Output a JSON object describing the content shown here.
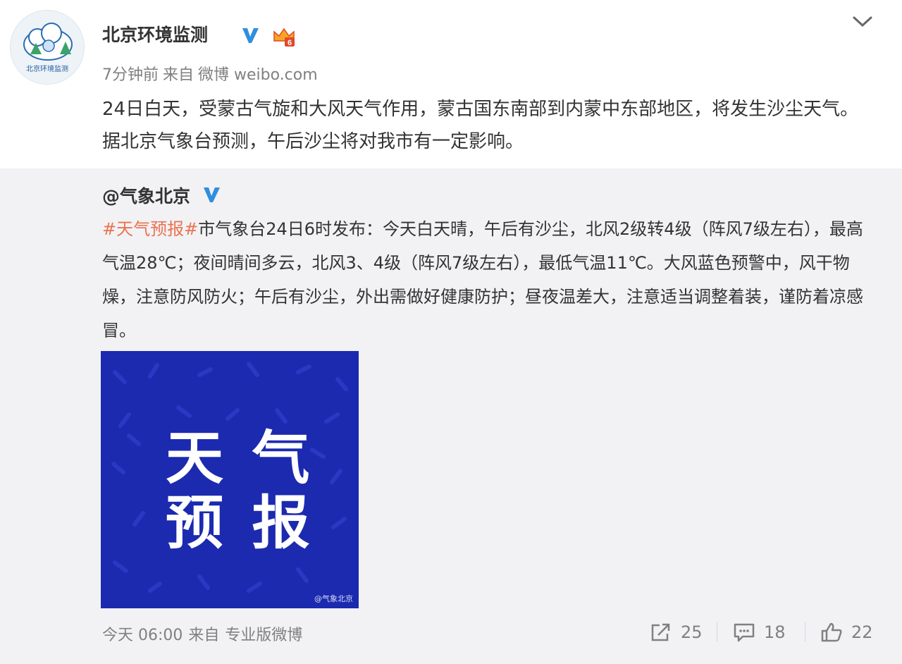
{
  "post": {
    "author": "北京环境监测",
    "avatar_caption": "北京环境监测",
    "time": "7分钟前",
    "source_prefix": "来自",
    "source": "微博 weibo.com",
    "text": "24日白天，受蒙古气旋和大风天气作用，蒙古国东南部到内蒙中东部地区，将发生沙尘天气。据北京气象台预测，午后沙尘将对我市有一定影响。",
    "badge_level": "6"
  },
  "repost": {
    "author": "@气象北京",
    "hashtag": "#天气预报#",
    "text": "市气象台24日6时发布：今天白天晴，午后有沙尘，北风2级转4级（阵风7级左右），最高气温28℃；夜间晴间多云，北风3、4级（阵风7级左右），最低气温11℃。大风蓝色预警中，风干物燥，注意防风防火；午后有沙尘，外出需做好健康防护；昼夜温差大，注意适当调整着装，谨防着凉感冒。",
    "image": {
      "line1": "天 气",
      "line2": "预 报",
      "watermark": "@气象北京",
      "background": "#1c2ab0"
    },
    "time": "今天 06:00",
    "source_prefix": "来自",
    "source": "专业版微博",
    "actions": {
      "repost_count": "25",
      "comment_count": "18",
      "like_count": "22"
    }
  },
  "colors": {
    "hashtag": "#eb7350",
    "verified": "#2f8fdf",
    "meta": "#808080",
    "repost_bg": "#f2f2f5"
  },
  "icons": [
    "verified-icon",
    "crown-badge-icon",
    "chevron-down-icon",
    "repost-icon",
    "comment-icon",
    "like-icon"
  ]
}
